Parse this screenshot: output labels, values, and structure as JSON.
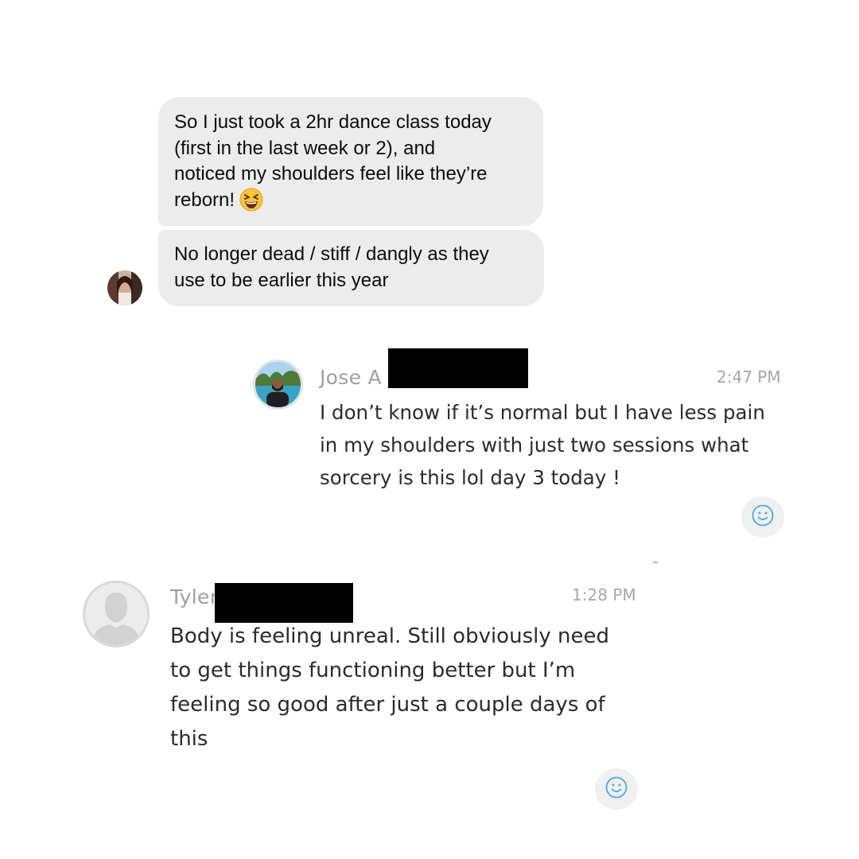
{
  "conversation": {
    "messages_top": [
      {
        "text_lines": [
          "So I just took a 2hr dance class today",
          "(first in the last week or 2), and",
          "noticed my shoulders feel like they’re",
          "reborn!"
        ],
        "emoji": "grinning-squinting-face"
      },
      {
        "text_lines": [
          "No longer dead / stiff / dangly as they",
          "use to be earlier this year"
        ]
      }
    ]
  },
  "posts": [
    {
      "author": "Jose A",
      "time": "2:47 PM",
      "lines": [
        "I don’t know if it’s normal but I have less pain",
        "in my shoulders with just two sessions what",
        "sorcery is this lol day 3 today !"
      ],
      "reaction_icon": "smiley-icon"
    },
    {
      "author": "Tyler",
      "time": "1:28 PM",
      "lines": [
        "Body is feeling unreal. Still obviously need",
        "to get things functioning better but I’m",
        "feeling so good after just a couple days of",
        "this"
      ],
      "reaction_icon": "smiley-icon"
    }
  ],
  "colors": {
    "bubble": "#ececec",
    "reaction_icon": "#4aa8e8",
    "redaction": "#000000"
  }
}
